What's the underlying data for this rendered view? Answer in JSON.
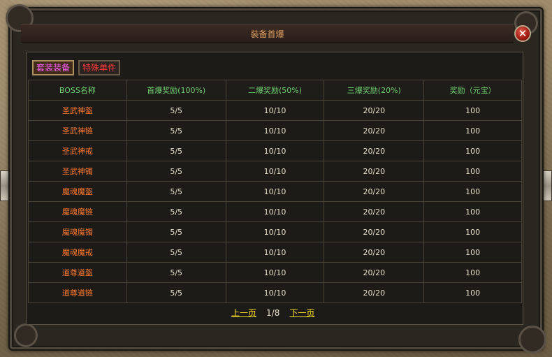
{
  "window": {
    "title": "装备首爆"
  },
  "tabs": [
    {
      "label": "套装装备"
    },
    {
      "label": "特殊单件"
    }
  ],
  "table": {
    "headers": [
      "BOSS名称",
      "首爆奖励(100%)",
      "二爆奖励(50%)",
      "三爆奖励(20%)",
      "奖励（元宝）"
    ],
    "rows": [
      [
        "圣武神盔",
        "5/5",
        "10/10",
        "20/20",
        "100"
      ],
      [
        "圣武神链",
        "5/5",
        "10/10",
        "20/20",
        "100"
      ],
      [
        "圣武神戒",
        "5/5",
        "10/10",
        "20/20",
        "100"
      ],
      [
        "圣武神镯",
        "5/5",
        "10/10",
        "20/20",
        "100"
      ],
      [
        "魔魂魔盔",
        "5/5",
        "10/10",
        "20/20",
        "100"
      ],
      [
        "魔魂魔链",
        "5/5",
        "10/10",
        "20/20",
        "100"
      ],
      [
        "魔魂魔镯",
        "5/5",
        "10/10",
        "20/20",
        "100"
      ],
      [
        "魔魂魔戒",
        "5/5",
        "10/10",
        "20/20",
        "100"
      ],
      [
        "道尊道盔",
        "5/5",
        "10/10",
        "20/20",
        "100"
      ],
      [
        "道尊道链",
        "5/5",
        "10/10",
        "20/20",
        "100"
      ]
    ]
  },
  "pager": {
    "prev_label": "上一页",
    "page_indicator": "1/8",
    "next_label": "下一页"
  },
  "colors": {
    "title": "#e0a060",
    "header": "#6fd070",
    "boss_name": "#ff7a30",
    "value": "#e8e0cc",
    "tab_active": "#ff60ff",
    "tab_inactive": "#ff3a3a",
    "pager_link": "#ffe020"
  }
}
